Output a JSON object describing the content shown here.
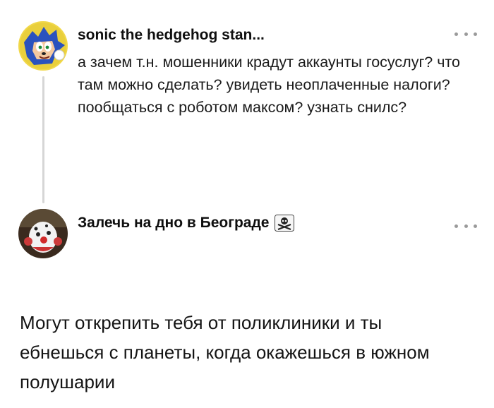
{
  "post": {
    "username": "sonic the hedgehog stan...",
    "text": "а зачем т.н. мошенники крадут аккаунты госуслуг? что там можно сделать? увидеть неоплаченные налоги? пообщаться с роботом максом? узнать снилс?",
    "avatar_icon": "sonic-avatar-icon",
    "more_icon": "more-dots-icon"
  },
  "reply": {
    "username": "Залечь на дно в Београде",
    "badge_icon": "skull-crossbones-icon",
    "text": "Могут открепить тебя от поликлиники и ты ебнешься с планеты, когда окажешься в южном полушарии",
    "avatar_icon": "clown-avatar-icon",
    "more_icon": "more-dots-icon"
  },
  "colors": {
    "thread_line": "#d6d6d6",
    "more_dots": "#9a9a9a",
    "text": "#1a1a1a"
  }
}
